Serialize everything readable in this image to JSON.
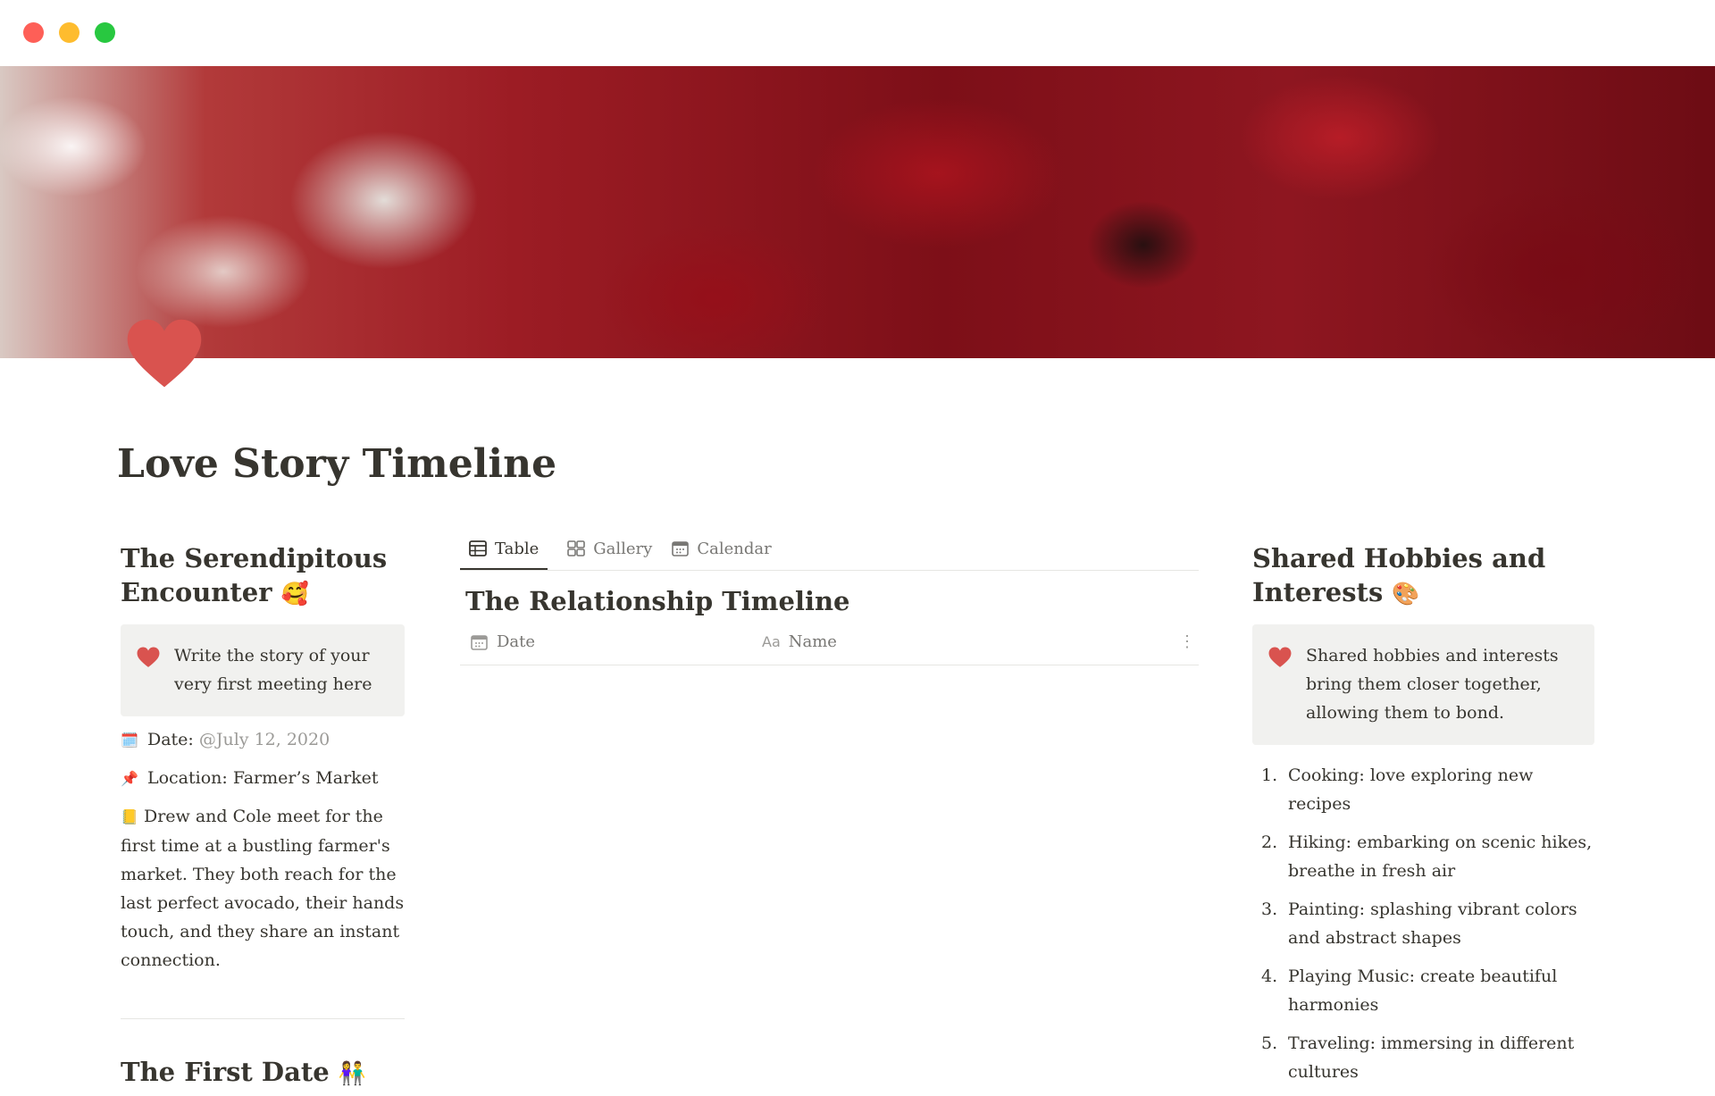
{
  "window": {
    "controls": [
      "close",
      "minimize",
      "maximize"
    ]
  },
  "cover": {
    "description_colors": {
      "accent": "#d9534f"
    }
  },
  "page": {
    "icon": "heart-icon",
    "title": "Love Story Timeline"
  },
  "left": {
    "heading_line1": "The Serendipitous",
    "heading_line2": "Encounter",
    "heading_emoji": "🥰",
    "callout": {
      "icon": "heart-icon",
      "text": "Write the story of your very first meeting here"
    },
    "date_label": "Date:",
    "date_icon": "🗓️",
    "date_value": "@July 12, 2020",
    "location_icon": "📌",
    "location_label": "Location: Farmer’s Market",
    "story_icon": "📒",
    "story_text": "Drew and Cole meet for the first time at a bustling farmer's market. They both reach for the last perfect avocado, their hands touch, and they share an instant connection.",
    "next_heading": "The First Date",
    "next_heading_emoji": "👫"
  },
  "middle": {
    "tabs": [
      {
        "label": "Table",
        "icon": "table-icon",
        "active": true
      },
      {
        "label": "Gallery",
        "icon": "gallery-icon",
        "active": false
      },
      {
        "label": "Calendar",
        "icon": "calendar-icon",
        "active": false
      }
    ],
    "database_title": "The Relationship Timeline",
    "columns": [
      {
        "label": "Date",
        "icon": "calendar-icon"
      },
      {
        "label": "Name",
        "icon": "text-icon",
        "icon_text": "Aa"
      }
    ],
    "more_label": "⋮"
  },
  "right": {
    "heading_line1": "Shared Hobbies and",
    "heading_line2": "Interests",
    "heading_emoji": "🎨",
    "callout": {
      "icon": "heart-icon",
      "text": "Shared hobbies and interests bring them closer together, allowing them to bond."
    },
    "hobbies": [
      {
        "num": "1.",
        "text": "Cooking: love exploring new recipes"
      },
      {
        "num": "2.",
        "text": "Hiking: embarking on scenic hikes, breathe in fresh air"
      },
      {
        "num": "3.",
        "text": "Painting: splashing vibrant colors and abstract shapes"
      },
      {
        "num": "4.",
        "text": "Playing Music: create beautiful harmonies"
      },
      {
        "num": "5.",
        "text": "Traveling: immersing  in different cultures"
      }
    ]
  }
}
